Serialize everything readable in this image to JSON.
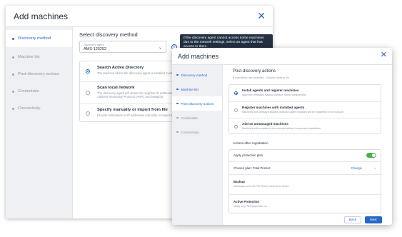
{
  "back_dialog": {
    "title": "Add machines",
    "nav": [
      {
        "label": "Discovery method"
      },
      {
        "label": "Machine list"
      },
      {
        "label": "Post-discovery actions"
      },
      {
        "label": "Credentials"
      },
      {
        "label": "Connectivity"
      }
    ],
    "heading": "Select discovery method",
    "agent_field": {
      "label": "Discovery agent",
      "value": "AMS-125252"
    },
    "tooltip": "If the discovery agent cannot access some machines due to the network settings, select an agent that has access to them.",
    "options": [
      {
        "title": "Search Active Directory",
        "desc": "The machine where the discovery agent is installed must be a member of the domain."
      },
      {
        "title": "Scan local network",
        "desc": "The discovery agent will obtain the neighbor IP addresses by using Active Directory, Address Resolution Protocol (ARP), and NetBIOS."
      },
      {
        "title": "Specify manually or import from file",
        "desc": "Provide hostnames or IP addresses manually or import them from a text file."
      }
    ]
  },
  "front_dialog": {
    "title": "Add machines",
    "nav": [
      {
        "label": "Discovery method"
      },
      {
        "label": "Machine list"
      },
      {
        "label": "Post-discovery actions"
      },
      {
        "label": "Credentials"
      },
      {
        "label": "Connectivity"
      }
    ],
    "heading": "Post-discovery actions",
    "subheading": "8 machines are selected. Choose what to do.",
    "options": [
      {
        "title": "Install agents and register machines",
        "desc": "Agent for Windows, Backup Advisor. Select components"
      },
      {
        "title": "Register machines with installed agents",
        "desc": "Machines with already installed protection agent installed will be registered in the console."
      },
      {
        "title": "Add as unmanaged machines",
        "desc": "Machines will be added to the console without component installation."
      }
    ],
    "actions_heading": "Actions after registration",
    "protection": {
      "apply_label": "Apply protection plan",
      "plan_label": "Chosen plan: Total Protect",
      "change_link": "Change",
      "backup_title": "Backup",
      "backup_desc": "Weekdays at 11:00 PM, Entire machine to Cloud",
      "ap_title": "Active Protection",
      "ap_desc": "Notify only, Self-protection on"
    },
    "buttons": {
      "back": "Back",
      "next": "Next"
    }
  },
  "colors": {
    "accent": "#2668c5",
    "toggle_on": "#4caf50",
    "nav_bg": "#eef0f3",
    "tooltip_bg": "#243143"
  },
  "icons": {
    "close": "close-icon",
    "info": "info-icon",
    "dropdown": "chevron-down-icon"
  }
}
